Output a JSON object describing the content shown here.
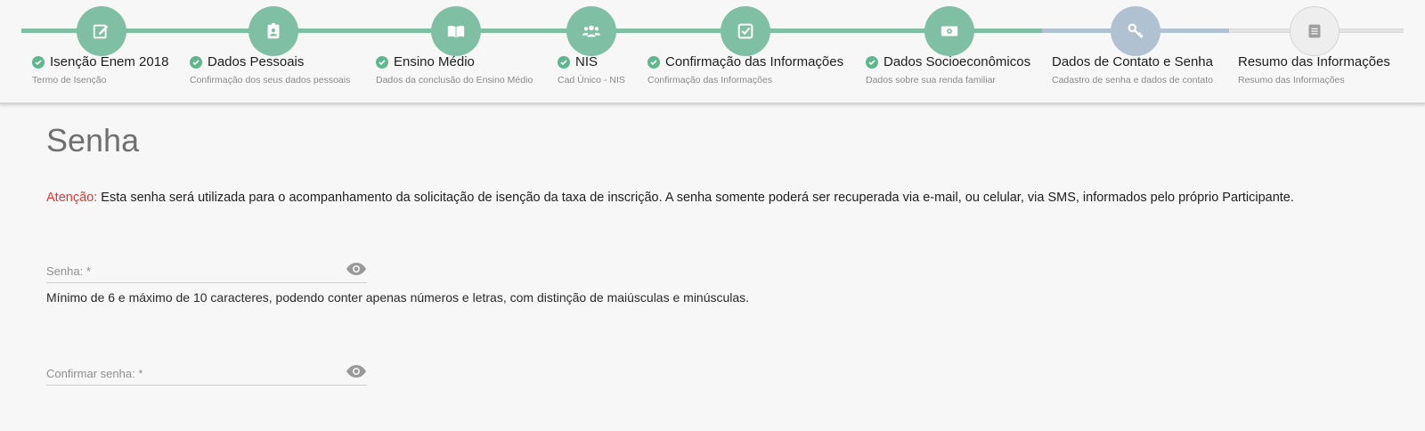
{
  "stepper": {
    "steps": [
      {
        "title": "Isenção Enem 2018",
        "subtitle": "Termo de Isenção",
        "status": "done",
        "icon": "edit-icon"
      },
      {
        "title": "Dados Pessoais",
        "subtitle": "Confirmação dos seus dados pessoais",
        "status": "done",
        "icon": "id-badge-icon"
      },
      {
        "title": "Ensino Médio",
        "subtitle": "Dados da conclusão do Ensino Médio",
        "status": "done",
        "icon": "book-icon"
      },
      {
        "title": "NIS",
        "subtitle": "Cad Único - NIS",
        "status": "done",
        "icon": "users-icon"
      },
      {
        "title": "Confirmação das Informações",
        "subtitle": "Confirmação das Informações",
        "status": "done",
        "icon": "checkbox-icon"
      },
      {
        "title": "Dados Socioeconômicos",
        "subtitle": "Dados sobre sua renda familiar",
        "status": "done",
        "icon": "money-icon"
      },
      {
        "title": "Dados de Contato e Senha",
        "subtitle": "Cadastro de senha e dados de contato",
        "status": "current",
        "icon": "key-icon"
      },
      {
        "title": "Resumo das Informações",
        "subtitle": "Resumo das Informações",
        "status": "todo",
        "icon": "document-icon"
      }
    ]
  },
  "page": {
    "title": "Senha",
    "attention_label": "Atenção:",
    "attention_text": " Esta senha será utilizada para o acompanhamento da solicitação de isenção da taxa de inscrição. A senha somente poderá ser recuperada via e-mail, ou celular, via SMS, informados pelo próprio Participante."
  },
  "form": {
    "password_placeholder": "Senha: *",
    "password_hint": "Mínimo de 6 e máximo de 10 caracteres, podendo conter apenas números e letras, com distinção de maiúsculas e minúsculas.",
    "confirm_placeholder": "Confirmar senha: *"
  },
  "colors": {
    "done": "#7fbfa3",
    "current": "#b0c1d2",
    "todo": "#eeeeee",
    "check": "#5fb88d",
    "warning": "#e53935"
  }
}
